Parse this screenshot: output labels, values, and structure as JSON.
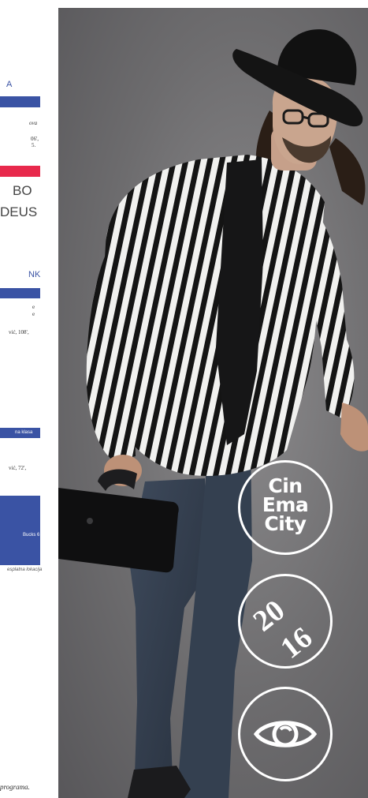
{
  "program": {
    "items": [
      {
        "text": "A",
        "color": "#3a53a4"
      },
      {
        "text": "ova",
        "color": "#333333"
      },
      {
        "text": "06',",
        "color": "#333333"
      },
      {
        "text": "5.",
        "color": "#333333"
      },
      {
        "text": "BO",
        "color": "#333333"
      },
      {
        "text": "DEUS",
        "color": "#333333"
      },
      {
        "text": "NK",
        "color": "#3a53a4"
      },
      {
        "text": "e",
        "color": "#333333"
      },
      {
        "text": "e",
        "color": "#333333"
      },
      {
        "text": "vić, 108',",
        "color": "#333333"
      },
      {
        "text": "vić, 72',",
        "color": "#333333"
      }
    ],
    "bar_label": "na klasa",
    "box_label": "Bucks 6",
    "note": "esplatna lokacija",
    "footer": "programa."
  },
  "logos": [
    {
      "kind": "wordmark",
      "lines": [
        "Cin",
        "Ema",
        "City"
      ]
    },
    {
      "kind": "year",
      "top": "20",
      "bottom": "16"
    },
    {
      "kind": "eye",
      "icon": "eye-icon"
    }
  ],
  "colors": {
    "accent_blue": "#3a53a4",
    "accent_red": "#e8294c",
    "badge": "#ffffff"
  }
}
